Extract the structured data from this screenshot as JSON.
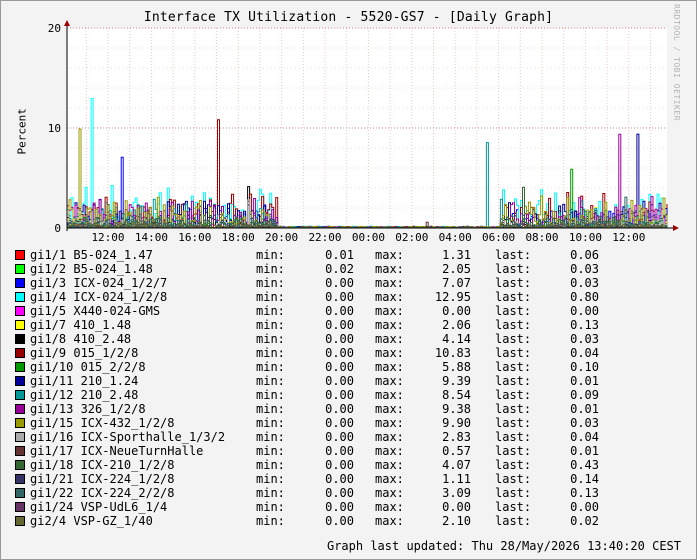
{
  "title": "Interface TX Utilization - 5520-GS7 - [Daily Graph]",
  "watermark": "RRDTOOL / TOBI OETIKER",
  "footer": "Graph last updated: Thu 28/May/2026 13:40:20 CEST",
  "legend_labels": {
    "min": "min:",
    "max": "max:",
    "last": "last:"
  },
  "chart_data": {
    "type": "line",
    "ylabel": "Percent",
    "ylim": [
      0,
      20
    ],
    "yticks": [
      0,
      10,
      20
    ],
    "xlabels": [
      "12:00",
      "14:00",
      "16:00",
      "18:00",
      "20:00",
      "22:00",
      "00:00",
      "02:00",
      "04:00",
      "06:00",
      "08:00",
      "10:00",
      "12:00"
    ],
    "grid": true,
    "series": [
      {
        "name": "gi1/1 B5-024_1.47",
        "color": "#ff0000",
        "min": "0.01",
        "max": "1.31",
        "last": "0.06"
      },
      {
        "name": "gi1/2 B5-024_1.48",
        "color": "#00ff00",
        "min": "0.02",
        "max": "2.05",
        "last": "0.03"
      },
      {
        "name": "gi1/3 ICX-024_1/2/7",
        "color": "#0000ff",
        "min": "0.00",
        "max": "7.07",
        "last": "0.03"
      },
      {
        "name": "gi1/4 ICX-024_1/2/8",
        "color": "#00ffff",
        "min": "0.00",
        "max": "12.95",
        "last": "0.80"
      },
      {
        "name": "gi1/5 X440-024-GMS",
        "color": "#ff00ff",
        "min": "0.00",
        "max": "0.00",
        "last": "0.00"
      },
      {
        "name": "gi1/7 410_1.48",
        "color": "#ffff00",
        "min": "0.00",
        "max": "2.06",
        "last": "0.13"
      },
      {
        "name": "gi1/8 410_2.48",
        "color": "#000000",
        "min": "0.00",
        "max": "4.14",
        "last": "0.03"
      },
      {
        "name": "gi1/9 015_1/2/8",
        "color": "#990000",
        "min": "0.00",
        "max": "10.83",
        "last": "0.04"
      },
      {
        "name": "gi1/10 015_2/2/8",
        "color": "#009900",
        "min": "0.00",
        "max": "5.88",
        "last": "0.10"
      },
      {
        "name": "gi1/11 210_1.24",
        "color": "#000099",
        "min": "0.00",
        "max": "9.39",
        "last": "0.01"
      },
      {
        "name": "gi1/12 210_2.48",
        "color": "#009999",
        "min": "0.00",
        "max": "8.54",
        "last": "0.09"
      },
      {
        "name": "gi1/13 326_1/2/8",
        "color": "#990099",
        "min": "0.00",
        "max": "9.38",
        "last": "0.01"
      },
      {
        "name": "gi1/15 ICX-432_1/2/8",
        "color": "#999900",
        "min": "0.00",
        "max": "9.90",
        "last": "0.03"
      },
      {
        "name": "gi1/16 ICX-Sporthalle_1/3/2",
        "color": "#aaaaaa",
        "min": "0.00",
        "max": "2.83",
        "last": "0.04"
      },
      {
        "name": "gi1/17 ICX-NeueTurnHalle",
        "color": "#663333",
        "min": "0.00",
        "max": "0.57",
        "last": "0.01"
      },
      {
        "name": "gi1/18 ICX-210_1/2/8",
        "color": "#336633",
        "min": "0.00",
        "max": "4.07",
        "last": "0.43"
      },
      {
        "name": "gi1/21 ICX-224_1/2/8",
        "color": "#333366",
        "min": "0.00",
        "max": "1.11",
        "last": "0.14"
      },
      {
        "name": "gi1/22 ICX-224_2/2/8",
        "color": "#336666",
        "min": "0.00",
        "max": "3.09",
        "last": "0.13"
      },
      {
        "name": "gi1/24 VSP-UdL6_1/4",
        "color": "#663366",
        "min": "0.00",
        "max": "0.00",
        "last": "0.00"
      },
      {
        "name": "gi2/4 VSP-GZ_1/40",
        "color": "#666633",
        "min": "0.00",
        "max": "2.10",
        "last": "0.02"
      }
    ]
  }
}
